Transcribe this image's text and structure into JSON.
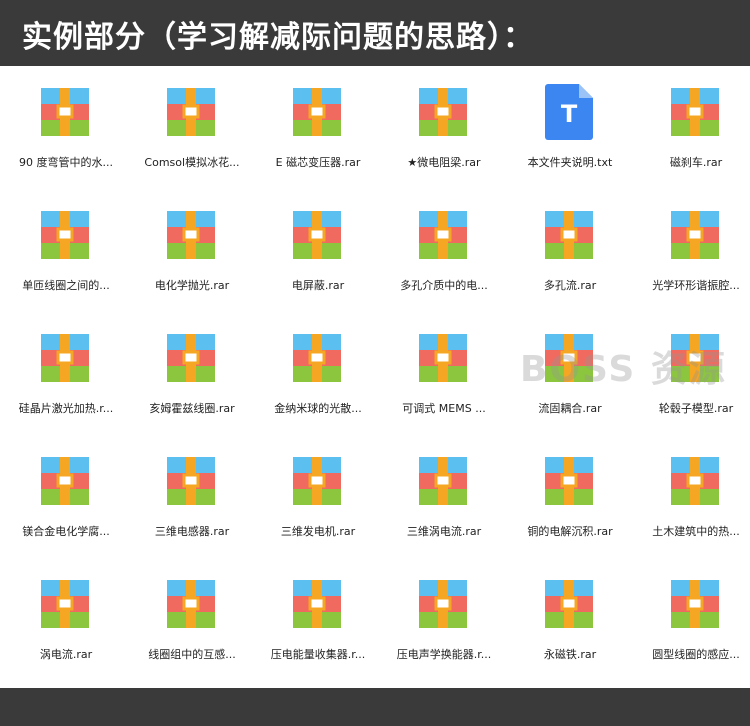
{
  "header": {
    "title": "实例部分（学习解减际问题的思路）："
  },
  "watermark": "BOSS 资源",
  "files": [
    {
      "label": "90 度弯管中的水...",
      "type": "rar"
    },
    {
      "label": "Comsol模拟冰花...",
      "type": "rar"
    },
    {
      "label": "E 磁芯变压器.rar",
      "type": "rar"
    },
    {
      "label": "★微电阻梁.rar",
      "type": "rar"
    },
    {
      "label": "本文件夹说明.txt",
      "type": "txt"
    },
    {
      "label": "磁刹车.rar",
      "type": "rar"
    },
    {
      "label": "单匝线圈之间的...",
      "type": "rar"
    },
    {
      "label": "电化学抛光.rar",
      "type": "rar"
    },
    {
      "label": "电屏蔽.rar",
      "type": "rar"
    },
    {
      "label": "多孔介质中的电...",
      "type": "rar"
    },
    {
      "label": "多孔流.rar",
      "type": "rar"
    },
    {
      "label": "光学环形谐振腔...",
      "type": "rar"
    },
    {
      "label": "硅晶片激光加热.r...",
      "type": "rar"
    },
    {
      "label": "亥姆霍兹线圈.rar",
      "type": "rar"
    },
    {
      "label": "金纳米球的光散...",
      "type": "rar"
    },
    {
      "label": "可调式 MEMS ...",
      "type": "rar"
    },
    {
      "label": "流固耦合.rar",
      "type": "rar"
    },
    {
      "label": "轮毂子模型.rar",
      "type": "rar"
    },
    {
      "label": "镁合金电化学腐...",
      "type": "rar"
    },
    {
      "label": "三维电感器.rar",
      "type": "rar"
    },
    {
      "label": "三维发电机.rar",
      "type": "rar"
    },
    {
      "label": "三维涡电流.rar",
      "type": "rar"
    },
    {
      "label": "铜的电解沉积.rar",
      "type": "rar"
    },
    {
      "label": "土木建筑中的热...",
      "type": "rar"
    },
    {
      "label": "涡电流.rar",
      "type": "rar"
    },
    {
      "label": "线圈组中的互感...",
      "type": "rar"
    },
    {
      "label": "压电能量收集器.r...",
      "type": "rar"
    },
    {
      "label": "压电声学换能器.r...",
      "type": "rar"
    },
    {
      "label": "永磁铁.rar",
      "type": "rar"
    },
    {
      "label": "圆型线圈的感应...",
      "type": "rar"
    }
  ],
  "txt_icon_letter": "T",
  "colors": {
    "rar_top": "#5bc0f0",
    "rar_mid": "#f06a5f",
    "rar_bot": "#8cc63f",
    "rar_band": "#f5a623",
    "txt_bg": "#3b86f0",
    "header_bg": "#3a3a3a"
  }
}
